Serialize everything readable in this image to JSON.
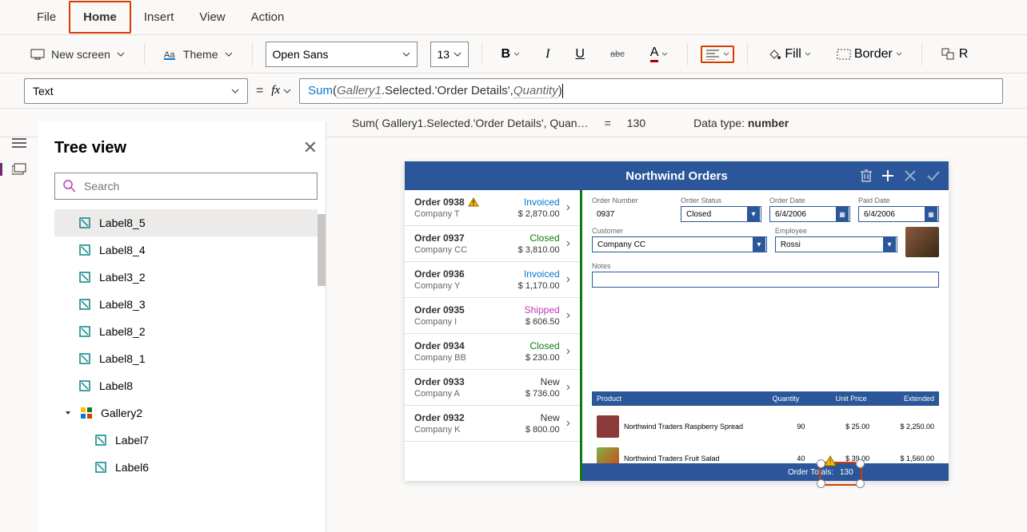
{
  "menubar": {
    "items": [
      "File",
      "Home",
      "Insert",
      "View",
      "Action"
    ],
    "active": "Home"
  },
  "ribbon": {
    "new_screen": "New screen",
    "theme": "Theme",
    "font": "Open Sans",
    "size": "13",
    "bold": "B",
    "italic": "I",
    "underline": "U",
    "strike": "abc",
    "fontcolor": "A",
    "fill": "Fill",
    "border": "Border",
    "reorder": "R"
  },
  "property": {
    "name": "Text"
  },
  "formula": {
    "raw": "Sum( Gallery1.Selected.'Order Details', Quantity )",
    "parts": {
      "fn": "Sum",
      "gallery": "Gallery1",
      "rest": ".Selected.'Order Details', ",
      "qty": "Quantity"
    }
  },
  "result": {
    "summary": "Sum( Gallery1.Selected.'Order Details', Quan…",
    "eq": "=",
    "value": "130",
    "dt_label": "Data type:",
    "dt_value": "number"
  },
  "tree": {
    "title": "Tree view",
    "search_placeholder": "Search",
    "items": [
      {
        "label": "Label8_5",
        "selected": true,
        "icon": "label",
        "indent": 0
      },
      {
        "label": "Label8_4",
        "icon": "label",
        "indent": 0
      },
      {
        "label": "Label3_2",
        "icon": "label",
        "indent": 0
      },
      {
        "label": "Label8_3",
        "icon": "label",
        "indent": 0
      },
      {
        "label": "Label8_2",
        "icon": "label",
        "indent": 0
      },
      {
        "label": "Label8_1",
        "icon": "label",
        "indent": 0
      },
      {
        "label": "Label8",
        "icon": "label",
        "indent": 0
      },
      {
        "label": "Gallery2",
        "icon": "gallery",
        "indent": 0,
        "expanded": true
      },
      {
        "label": "Label7",
        "icon": "label",
        "indent": 1
      },
      {
        "label": "Label6",
        "icon": "label",
        "indent": 1
      }
    ]
  },
  "app": {
    "title": "Northwind Orders",
    "orders": [
      {
        "id": "Order 0938",
        "company": "Company T",
        "status": "Invoiced",
        "status_class": "invoiced",
        "amount": "$ 2,870.00",
        "warn": true
      },
      {
        "id": "Order 0937",
        "company": "Company CC",
        "status": "Closed",
        "status_class": "closed",
        "amount": "$ 3,810.00"
      },
      {
        "id": "Order 0936",
        "company": "Company Y",
        "status": "Invoiced",
        "status_class": "invoiced",
        "amount": "$ 1,170.00"
      },
      {
        "id": "Order 0935",
        "company": "Company I",
        "status": "Shipped",
        "status_class": "shipped",
        "amount": "$ 606.50"
      },
      {
        "id": "Order 0934",
        "company": "Company BB",
        "status": "Closed",
        "status_class": "closed",
        "amount": "$ 230.00"
      },
      {
        "id": "Order 0933",
        "company": "Company A",
        "status": "New",
        "status_class": "new",
        "amount": "$ 736.00"
      },
      {
        "id": "Order 0932",
        "company": "Company K",
        "status": "New",
        "status_class": "new",
        "amount": "$ 800.00"
      }
    ],
    "detail": {
      "fields": {
        "order_number": {
          "label": "Order Number",
          "value": "0937"
        },
        "order_status": {
          "label": "Order Status",
          "value": "Closed"
        },
        "order_date": {
          "label": "Order Date",
          "value": "6/4/2006"
        },
        "paid_date": {
          "label": "Paid Date",
          "value": "6/4/2006"
        },
        "customer": {
          "label": "Customer",
          "value": "Company CC"
        },
        "employee": {
          "label": "Employee",
          "value": "Rossi"
        },
        "notes": {
          "label": "Notes",
          "value": ""
        }
      },
      "products": {
        "head": {
          "name": "Product",
          "qty": "Quantity",
          "up": "Unit Price",
          "ext": "Extended"
        },
        "rows": [
          {
            "name": "Northwind Traders Raspberry Spread",
            "qty": "90",
            "up": "$ 25.00",
            "ext": "$ 2,250.00",
            "img": "raspberry"
          },
          {
            "name": "Northwind Traders Fruit Salad",
            "qty": "40",
            "up": "$ 39.00",
            "ext": "$ 1,560.00",
            "img": "salad"
          }
        ]
      },
      "totals": {
        "label": "Order Totals:",
        "value": "130"
      }
    }
  }
}
